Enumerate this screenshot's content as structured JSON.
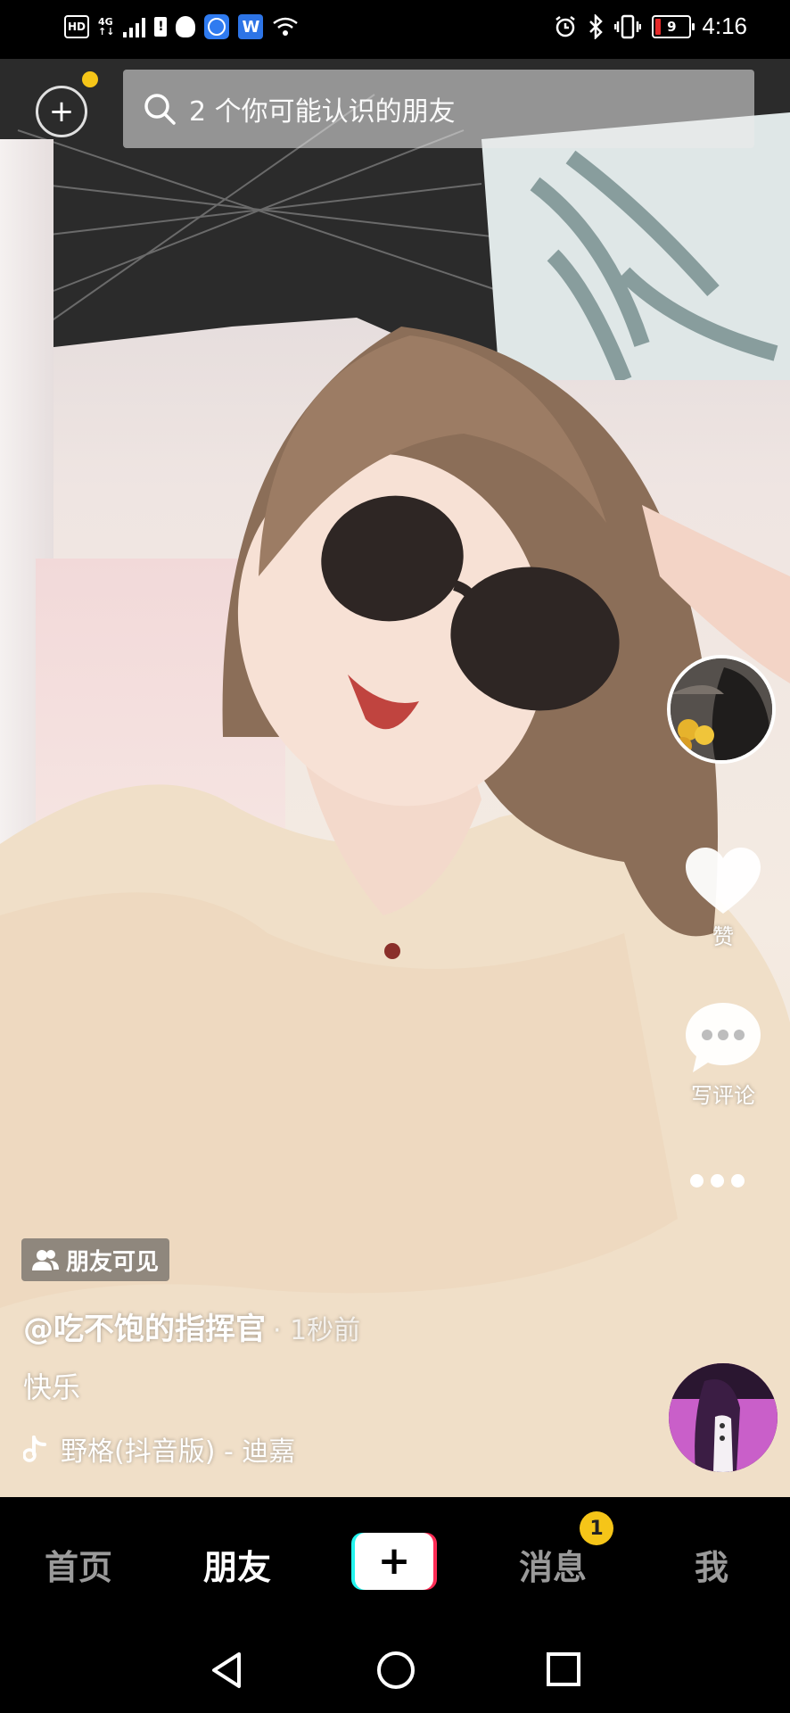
{
  "status_bar": {
    "hd_label": "HD",
    "network_label": "4G",
    "sim_label": "!",
    "app_w_label": "W",
    "battery_level": "9",
    "time": "4:16"
  },
  "top": {
    "search_placeholder": "2 个你可能认识的朋友"
  },
  "actions": {
    "like_label": "赞",
    "comment_label": "写评论"
  },
  "post": {
    "visibility": "朋友可见",
    "author": "@吃不饱的指挥官",
    "time": "· 1秒前",
    "caption": "快乐",
    "music": "野格(抖音版) - 迪嘉"
  },
  "tabs": {
    "home": "首页",
    "friends": "朋友",
    "messages": "消息",
    "me": "我",
    "messages_badge": "1"
  },
  "colors": {
    "badge_yellow": "#f5c518",
    "tiktok_cyan": "#25f4ee",
    "tiktok_red": "#fe2c55"
  }
}
